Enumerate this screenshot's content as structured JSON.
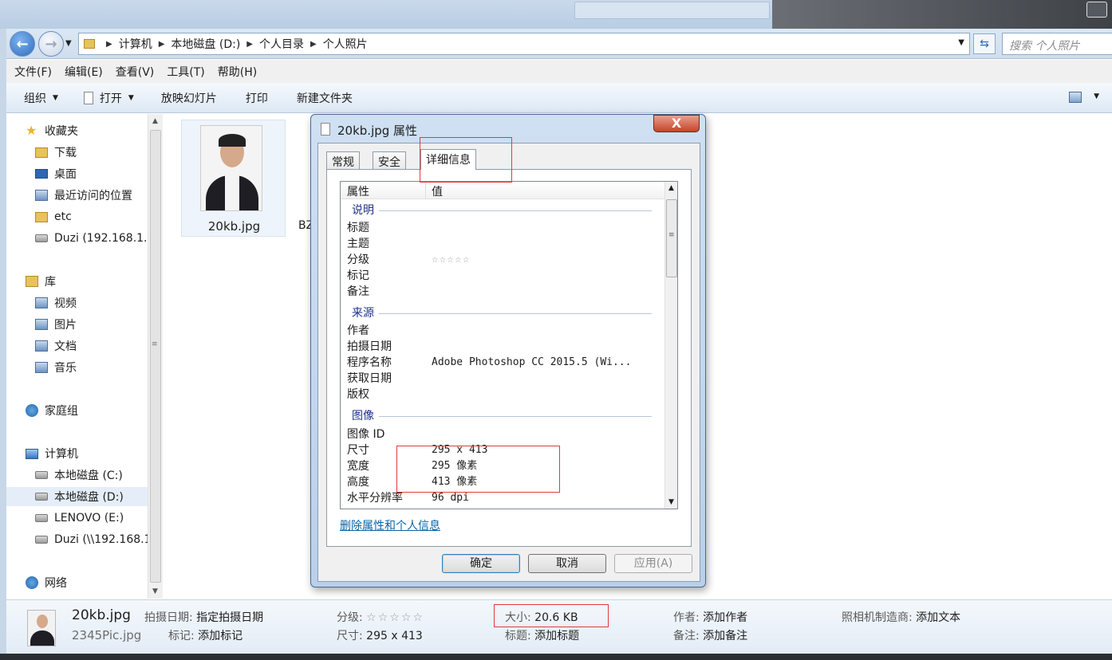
{
  "address": {
    "crumbs": [
      "计算机",
      "本地磁盘 (D:)",
      "个人目录",
      "个人照片"
    ],
    "search_placeholder": "搜索 个人照片"
  },
  "menu": [
    "文件(F)",
    "编辑(E)",
    "查看(V)",
    "工具(T)",
    "帮助(H)"
  ],
  "toolbar": {
    "organize": "组织",
    "open": "打开",
    "slideshow": "放映幻灯片",
    "print": "打印",
    "new_folder": "新建文件夹"
  },
  "sidebar": {
    "favorites": "收藏夹",
    "downloads": "下载",
    "desktop": "桌面",
    "recent": "最近访问的位置",
    "etc": "etc",
    "duzi_fav": "Duzi (192.168.1.",
    "libraries": "库",
    "videos": "视频",
    "pictures": "图片",
    "documents": "文档",
    "music": "音乐",
    "homegroup": "家庭组",
    "computer": "计算机",
    "drive_c": "本地磁盘 (C:)",
    "drive_d": "本地磁盘 (D:)",
    "drive_e": "LENOVO (E:)",
    "duzi_net": "Duzi (\\\\192.168.1",
    "network": "网络"
  },
  "content": {
    "file1_name": "20kb.jpg",
    "file2_partial": "BZ"
  },
  "dialog": {
    "title": "20kb.jpg 属性",
    "close": "X",
    "tabs": [
      "常规",
      "安全",
      "详细信息"
    ],
    "col_property": "属性",
    "col_value": "值",
    "groups": {
      "description": "说明",
      "origin": "来源",
      "image": "图像"
    },
    "rows": {
      "title": "标题",
      "subject": "主题",
      "rating": "分级",
      "rating_stars": "☆☆☆☆☆",
      "tags": "标记",
      "comments": "备注",
      "authors": "作者",
      "date_taken": "拍摄日期",
      "program": "程序名称",
      "program_value": "Adobe Photoshop CC 2015.5 (Wi...",
      "date_acquired": "获取日期",
      "copyright": "版权",
      "image_id": "图像 ID",
      "dimensions": "尺寸",
      "dimensions_value": "295 x 413",
      "width": "宽度",
      "width_value": "295 像素",
      "height": "高度",
      "height_value": "413 像素",
      "h_resolution": "水平分辨率",
      "h_resolution_value": "96 dpi"
    },
    "remove_link": "删除属性和个人信息",
    "ok": "确定",
    "cancel": "取消",
    "apply": "应用(A)"
  },
  "details": {
    "name": "20kb.jpg",
    "type": "2345Pic.jpg",
    "date_taken_label": "拍摄日期:",
    "date_taken_value": "指定拍摄日期",
    "tags_label": "标记:",
    "tags_value": "添加标记",
    "rating_label": "分级:",
    "rating_stars": "☆☆☆☆☆",
    "dims_label": "尺寸:",
    "dims_value": "295 x 413",
    "size_label": "大小:",
    "size_value": "20.6 KB",
    "title_label": "标题:",
    "title_value": "添加标题",
    "author_label": "作者:",
    "author_value": "添加作者",
    "comments_label": "备注:",
    "comments_value": "添加备注",
    "camera_label": "照相机制造商:",
    "camera_value": "添加文本"
  }
}
